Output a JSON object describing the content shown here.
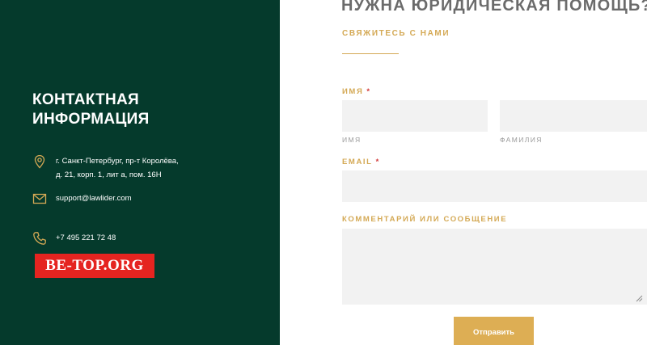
{
  "contact": {
    "title_line1": "КОНТАКТНАЯ",
    "title_line2": "ИНФОРМАЦИЯ",
    "address_line1": "г. Санкт-Петербург, пр-т Королёва,",
    "address_line2": "д. 21, корп. 1, лит а, пом. 16Н",
    "email": "support@lawlider.com",
    "phone": "+7 495 221 72 48",
    "icons": {
      "address": "map-pin-icon",
      "email": "mail-icon",
      "phone": "phone-icon"
    },
    "icon_color": "#d4a955",
    "background": "#053a2c"
  },
  "watermark": {
    "text": "BE-TOP.ORG",
    "color": "#e52420"
  },
  "form": {
    "heading": "НУЖНА ЮРИДИЧЕСКАЯ ПОМОЩЬ?",
    "subheading": "СВЯЖИТЕСЬ С НАМИ",
    "name_label": "ИМЯ",
    "required_mark": "*",
    "first_name_sublabel": "ИМЯ",
    "last_name_sublabel": "ФАМИЛИЯ",
    "first_name_value": "",
    "last_name_value": "",
    "email_label": "EMAIL",
    "email_value": "",
    "comment_label": "КОММЕНТАРИЙ ИЛИ СООБЩЕНИЕ",
    "comment_value": "",
    "submit_label": "Отправить",
    "accent_color": "#d4a955",
    "button_color": "#ddae54"
  }
}
